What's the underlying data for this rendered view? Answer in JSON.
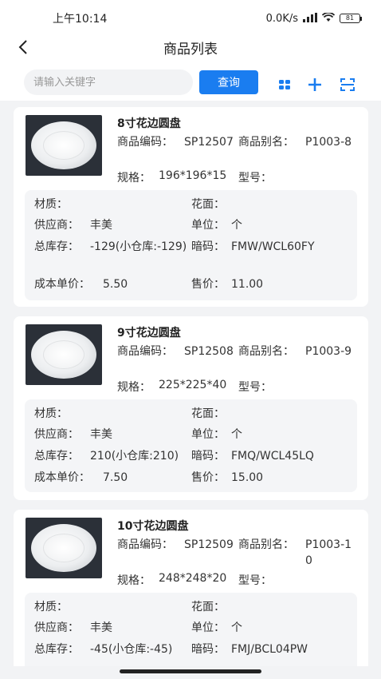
{
  "status": {
    "time": "上午10:14",
    "speed": "0.0K/s",
    "battery": "81"
  },
  "header": {
    "title": "商品列表"
  },
  "search": {
    "placeholder": "请输入关键字",
    "button_label": "查询"
  },
  "labels": {
    "code": "商品编码：",
    "alias": "商品别名：",
    "spec": "规格：",
    "model": "型号：",
    "material": "材质：",
    "pattern": "花面：",
    "supplier": "供应商：",
    "unit": "单位：",
    "stock": "总库存：",
    "hidden_code": "暗码：",
    "cost": "成本单价：",
    "price": "售价："
  },
  "products": [
    {
      "name": "8寸花边圆盘",
      "code": "SP12507",
      "alias": "P1003-8",
      "spec": "196*196*15",
      "supplier_val": "丰美",
      "unit_val": "个",
      "stock_val": "-129(小仓库:-129)",
      "hidden_code_val": "FMW/WCL60FY",
      "cost_val": "5.50",
      "price_val": "11.00"
    },
    {
      "name": "9寸花边圆盘",
      "code": "SP12508",
      "alias": "P1003-9",
      "spec": "225*225*40",
      "supplier_val": "丰美",
      "unit_val": "个",
      "stock_val": "210(小仓库:210)",
      "hidden_code_val": "FMQ/WCL45LQ",
      "cost_val": "7.50",
      "price_val": "15.00"
    },
    {
      "name": "10寸花边圆盘",
      "code": "SP12509",
      "alias": "P1003-10",
      "spec": "248*248*20",
      "supplier_val": "丰美",
      "unit_val": "个",
      "stock_val": "-45(小仓库:-45)",
      "hidden_code_val": "FMJ/BCL04PW"
    }
  ],
  "colors": {
    "accent": "#1a7df0",
    "background": "#f2f3f5",
    "detail_bg": "#f4f5f7"
  }
}
